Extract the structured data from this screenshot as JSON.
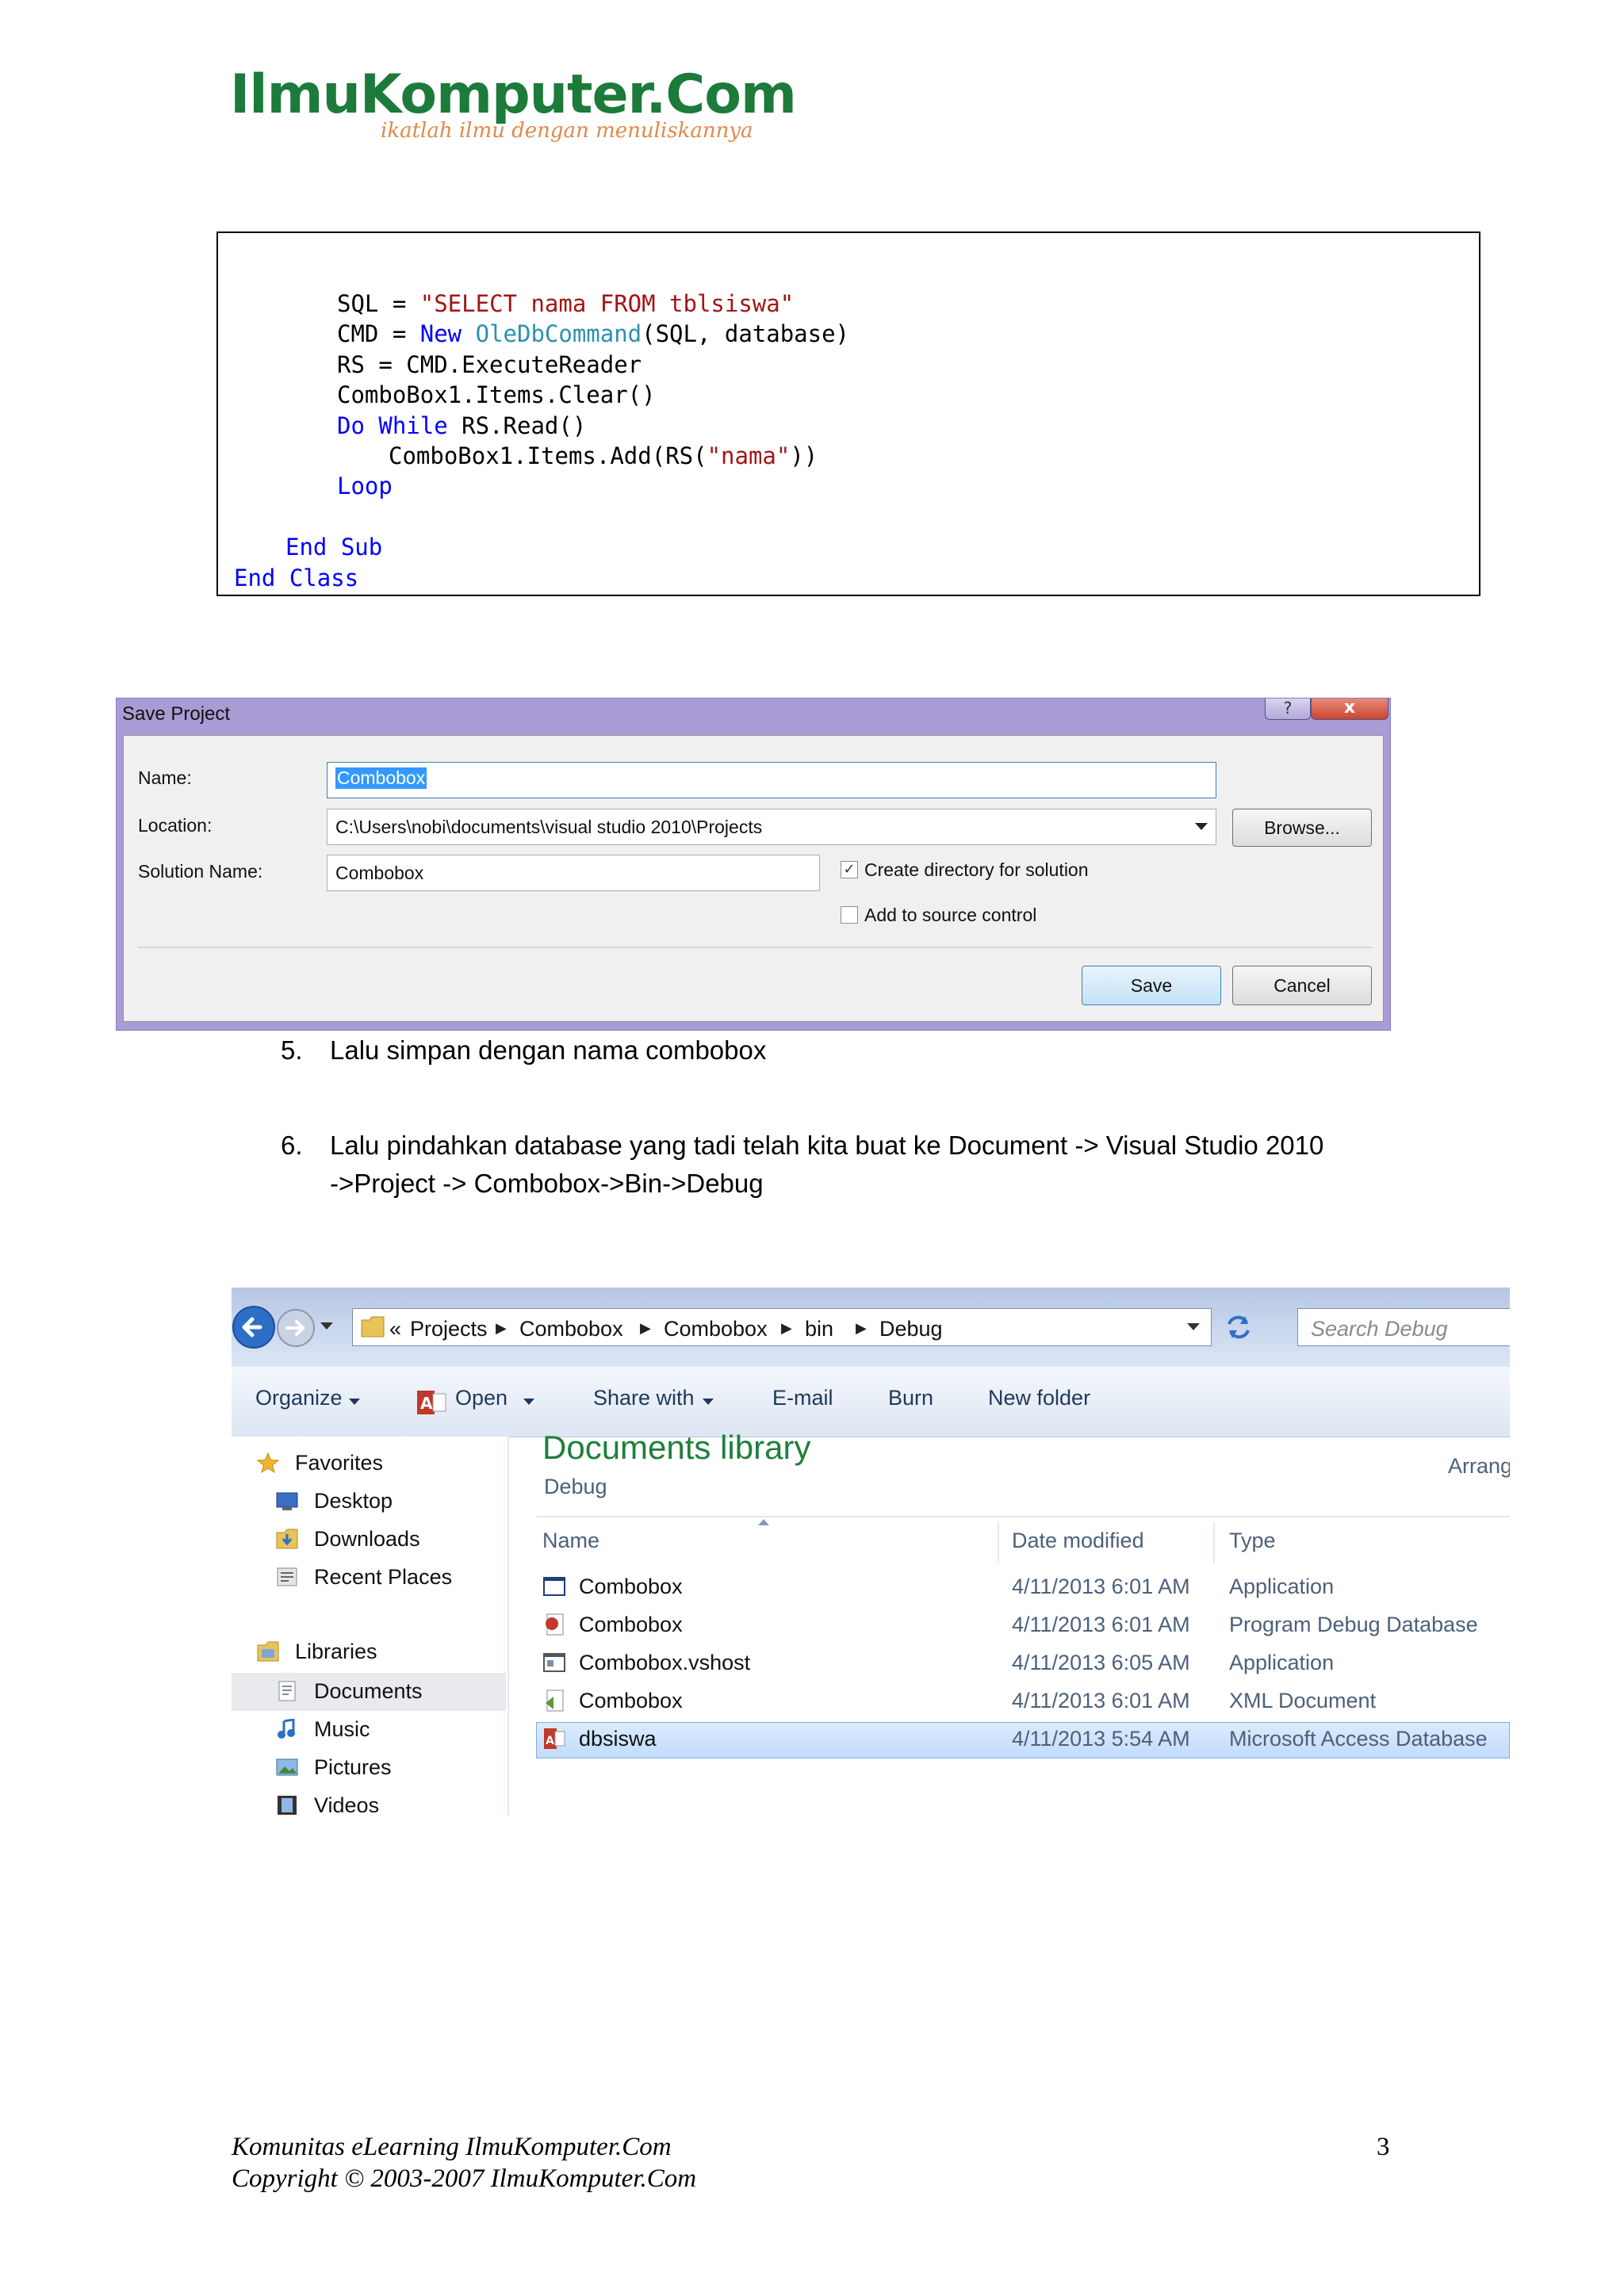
{
  "logo": {
    "brand": "IlmuKomputer.Com",
    "tagline": "ikatlah ilmu dengan menuliskannya"
  },
  "code": [
    {
      "indent": 2,
      "parts": [
        [
          "",
          "SQL = "
        ],
        [
          "str",
          "\"SELECT nama FROM tblsiswa\""
        ]
      ]
    },
    {
      "indent": 2,
      "parts": [
        [
          "",
          "CMD = "
        ],
        [
          "kw",
          "New "
        ],
        [
          "typ",
          "OleDbCommand"
        ],
        [
          "",
          "(SQL, database)"
        ]
      ]
    },
    {
      "indent": 2,
      "parts": [
        [
          "",
          "RS = CMD.ExecuteReader"
        ]
      ]
    },
    {
      "indent": 2,
      "parts": [
        [
          "",
          "ComboBox1.Items.Clear()"
        ]
      ]
    },
    {
      "indent": 2,
      "parts": [
        [
          "kw",
          "Do While "
        ],
        [
          "",
          "RS.Read()"
        ]
      ]
    },
    {
      "indent": 3,
      "parts": [
        [
          "",
          "ComboBox1.Items.Add(RS("
        ],
        [
          "str",
          "\"nama\""
        ],
        [
          "",
          "))"
        ]
      ]
    },
    {
      "indent": 2,
      "parts": [
        [
          "kw",
          "Loop"
        ]
      ]
    },
    {
      "indent": 0,
      "parts": []
    },
    {
      "indent": 1,
      "parts": [
        [
          "kw",
          "End Sub"
        ]
      ]
    },
    {
      "indent": 0,
      "parts": [
        [
          "kw",
          "End Class"
        ]
      ]
    }
  ],
  "dialog": {
    "title": "Save Project",
    "help_glyph": "?",
    "close_glyph": "x",
    "name_label": "Name:",
    "name_value": "Combobox",
    "location_label": "Location:",
    "location_value": "C:\\Users\\nobi\\documents\\visual studio 2010\\Projects",
    "browse_label": "Browse...",
    "solution_label": "Solution Name:",
    "solution_value": "Combobox",
    "create_dir_label": "Create directory for solution",
    "create_dir_checked": true,
    "source_control_label": "Add to source control",
    "source_control_checked": false,
    "save_label": "Save",
    "cancel_label": "Cancel"
  },
  "steps": {
    "s5_num": "5.",
    "s5_text": "Lalu simpan dengan nama combobox",
    "s6_num": "6.",
    "s6_line1": "Lalu pindahkan database yang tadi telah kita buat ke Document -> Visual Studio 2010",
    "s6_line2": "->Project -> Combobox->Bin->Debug"
  },
  "explorer": {
    "crumb_prefix": "«",
    "breadcrumb": [
      "Projects",
      "Combobox",
      "Combobox",
      "bin",
      "Debug"
    ],
    "search_placeholder": "Search Debug",
    "toolbar": {
      "organize": "Organize",
      "open": "Open",
      "share": "Share with",
      "email": "E-mail",
      "burn": "Burn",
      "new_folder": "New folder"
    },
    "nav": {
      "favorites": "Favorites",
      "desktop": "Desktop",
      "downloads": "Downloads",
      "recent": "Recent Places",
      "libraries": "Libraries",
      "documents": "Documents",
      "music": "Music",
      "pictures": "Pictures",
      "videos": "Videos"
    },
    "library_title": "Documents library",
    "library_sub": "Debug",
    "arrange": "Arrang",
    "columns": {
      "name": "Name",
      "date": "Date modified",
      "type": "Type"
    },
    "files": [
      {
        "name": "Combobox",
        "date": "4/11/2013 6:01 AM",
        "type": "Application"
      },
      {
        "name": "Combobox",
        "date": "4/11/2013 6:01 AM",
        "type": "Program Debug Database"
      },
      {
        "name": "Combobox.vshost",
        "date": "4/11/2013 6:05 AM",
        "type": "Application"
      },
      {
        "name": "Combobox",
        "date": "4/11/2013 6:01 AM",
        "type": "XML Document"
      },
      {
        "name": "dbsiswa",
        "date": "4/11/2013 5:54 AM",
        "type": "Microsoft Access Database"
      }
    ]
  },
  "footer": {
    "line1": "Komunitas eLearning IlmuKomputer.Com",
    "line2": "Copyright © 2003-2007 IlmuKomputer.Com",
    "page_number": "3"
  }
}
